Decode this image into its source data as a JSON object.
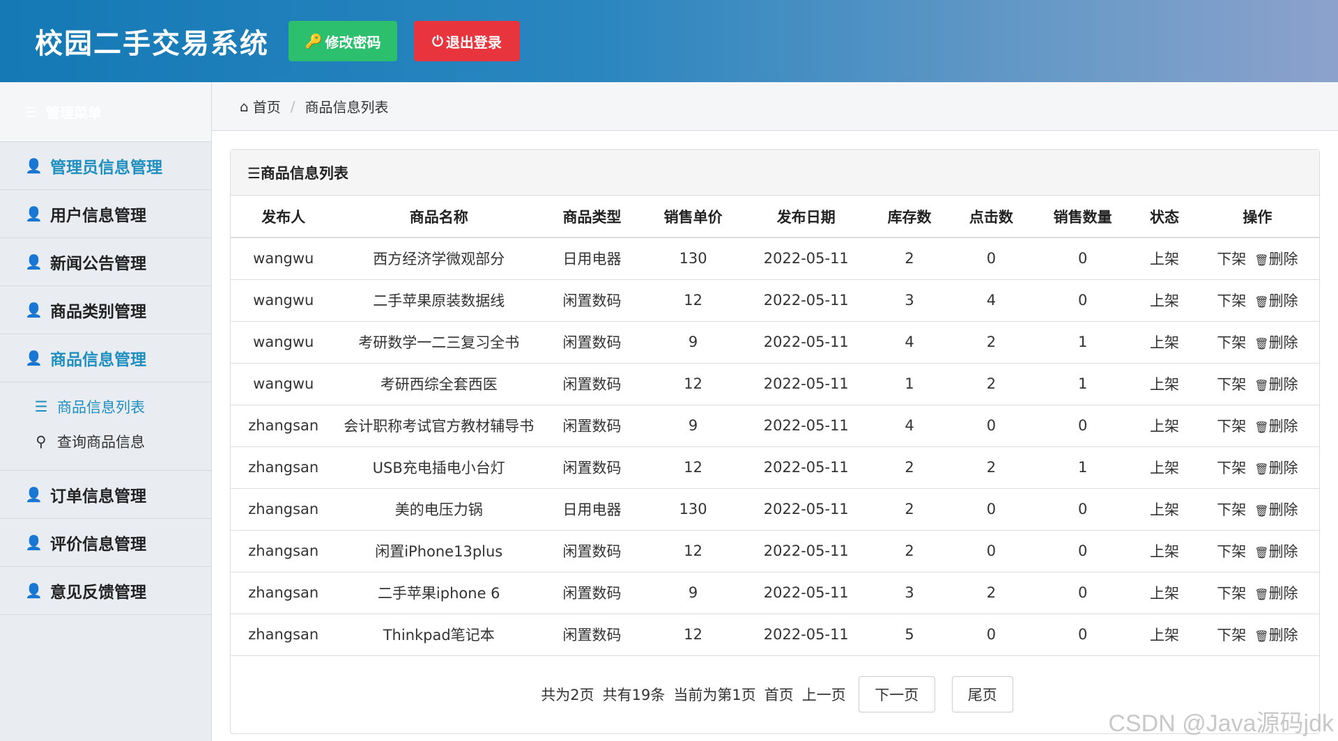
{
  "header": {
    "title": "校园二手交易系统",
    "change_password": "修改密码",
    "logout": "退出登录"
  },
  "sidebar": {
    "title": "管理菜单",
    "items": [
      {
        "label": "管理员信息管理",
        "active": true
      },
      {
        "label": "用户信息管理"
      },
      {
        "label": "新闻公告管理"
      },
      {
        "label": "商品类别管理"
      },
      {
        "label": "商品信息管理",
        "active": true
      }
    ],
    "sub_items": [
      {
        "label": "商品信息列表",
        "icon": "list-icon",
        "active": true
      },
      {
        "label": "查询商品信息",
        "icon": "search-icon"
      }
    ],
    "items_after": [
      {
        "label": "订单信息管理"
      },
      {
        "label": "评价信息管理"
      },
      {
        "label": "意见反馈管理"
      }
    ]
  },
  "breadcrumb": {
    "home": "首页",
    "current": "商品信息列表"
  },
  "panel": {
    "title": "☰商品信息列表"
  },
  "table": {
    "headers": [
      "发布人",
      "商品名称",
      "商品类型",
      "销售单价",
      "发布日期",
      "库存数",
      "点击数",
      "销售数量",
      "状态",
      "操作"
    ],
    "rows": [
      [
        "wangwu",
        "西方经济学微观部分",
        "日用电器",
        "130",
        "2022-05-11",
        "2",
        "0",
        "0",
        "上架"
      ],
      [
        "wangwu",
        "二手苹果原装数据线",
        "闲置数码",
        "12",
        "2022-05-11",
        "3",
        "4",
        "0",
        "上架"
      ],
      [
        "wangwu",
        "考研数学一二三复习全书",
        "闲置数码",
        "9",
        "2022-05-11",
        "4",
        "2",
        "1",
        "上架"
      ],
      [
        "wangwu",
        "考研西综全套西医",
        "闲置数码",
        "12",
        "2022-05-11",
        "1",
        "2",
        "1",
        "上架"
      ],
      [
        "zhangsan",
        "会计职称考试官方教材辅导书",
        "闲置数码",
        "9",
        "2022-05-11",
        "4",
        "0",
        "0",
        "上架"
      ],
      [
        "zhangsan",
        "USB充电插电小台灯",
        "闲置数码",
        "12",
        "2022-05-11",
        "2",
        "2",
        "1",
        "上架"
      ],
      [
        "zhangsan",
        "美的电压力锅",
        "日用电器",
        "130",
        "2022-05-11",
        "2",
        "0",
        "0",
        "上架"
      ],
      [
        "zhangsan",
        "闲置iPhone13plus",
        "闲置数码",
        "12",
        "2022-05-11",
        "2",
        "0",
        "0",
        "上架"
      ],
      [
        "zhangsan",
        "二手苹果iphone 6",
        "闲置数码",
        "9",
        "2022-05-11",
        "3",
        "2",
        "0",
        "上架"
      ],
      [
        "zhangsan",
        "Thinkpad笔记本",
        "闲置数码",
        "12",
        "2022-05-11",
        "5",
        "0",
        "0",
        "上架"
      ]
    ],
    "op_down": "下架",
    "op_delete": "删除"
  },
  "pager": {
    "total_pages": "共为2页",
    "total_items": "共有19条",
    "current": "当前为第1页",
    "first": "首页",
    "prev": "上一页",
    "next": "下一页",
    "last": "尾页"
  },
  "watermark": "CSDN @Java源码jdk",
  "colors": {
    "header_start": "#1479b5",
    "green_button": "#2bbf6e",
    "red_button": "#e8343c",
    "active_menu": "#1f8fc0"
  }
}
